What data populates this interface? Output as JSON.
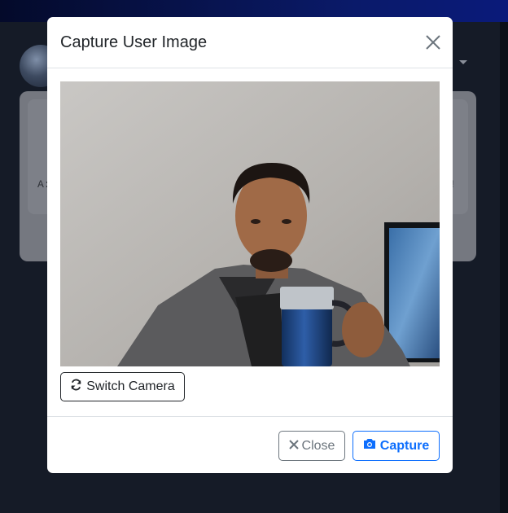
{
  "background_app": {
    "card_text_left": "A:",
    "card_text_right": "!"
  },
  "modal": {
    "title": "Capture User Image",
    "switch_camera_label": "Switch Camera",
    "close_label": "Close",
    "capture_label": "Capture"
  },
  "colors": {
    "primary": "#0d6efd",
    "secondary": "#6c757d",
    "text": "#212529",
    "topbar": "#0a1a6a"
  },
  "icons": {
    "close": "close-icon",
    "switch": "refresh-icon",
    "close_button": "times-icon",
    "capture": "camera-icon"
  }
}
